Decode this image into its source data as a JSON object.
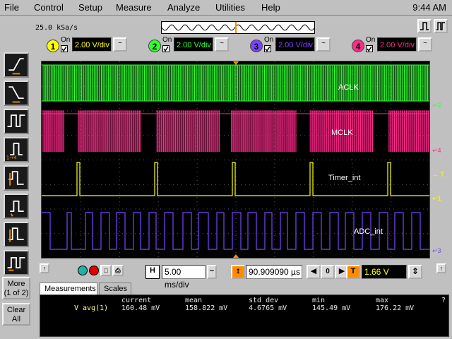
{
  "menubar": {
    "items": [
      "File",
      "Control",
      "Setup",
      "Measure",
      "Analyze",
      "Utilities",
      "Help"
    ],
    "clock": "9:44 AM"
  },
  "acquisition": {
    "sample_rate": "25.0 kSa/s"
  },
  "channels": [
    {
      "number": "1",
      "on_label": "On",
      "scale": "2.00 V/div",
      "color": "#ffff00"
    },
    {
      "number": "2",
      "on_label": "On",
      "scale": "2.00 V/div",
      "color": "#33ff33"
    },
    {
      "number": "3",
      "on_label": "On",
      "scale": "2.00 V/div",
      "color": "#7a44ff"
    },
    {
      "number": "4",
      "on_label": "On",
      "scale": "2.00 V/div",
      "color": "#ff2a8a"
    }
  ],
  "waveforms": {
    "aclk_label": "ACLK",
    "mclk_label": "MCLK",
    "timer_label": "Timer_int",
    "adc_label": "ADC_int",
    "colors": {
      "aclk": "#33ff33",
      "mclk": "#ff2a8a",
      "timer": "#ffff00",
      "adc": "#7a44ff"
    }
  },
  "timebase": {
    "scale": "5.00 ms/div",
    "delay": "90.909090 µs",
    "trigger_level": "1.66 V",
    "h_label": "H",
    "t_label": "T"
  },
  "leftbar": {
    "more_line1": "More",
    "more_line2": "(1 of 2)",
    "clear_line1": "Clear",
    "clear_line2": "All"
  },
  "measurements": {
    "tabs": [
      "Measurements",
      "Scales"
    ],
    "columns": [
      "current",
      "mean",
      "std dev",
      "min",
      "max"
    ],
    "rows": [
      {
        "name": "V avg(1)",
        "current": "160.48 mV",
        "mean": "158.822 mV",
        "std_dev": "4.6765 mV",
        "min": "145.49 mV",
        "max": "176.22 mV"
      }
    ],
    "help": "?"
  }
}
